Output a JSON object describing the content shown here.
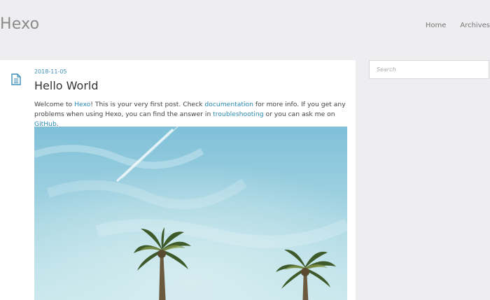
{
  "site": {
    "title": "Hexo"
  },
  "nav": {
    "items": [
      {
        "label": "Home"
      },
      {
        "label": "Archives"
      }
    ]
  },
  "post": {
    "date": "2018-11-05",
    "title": "Hello World",
    "text": {
      "p1": "Welcome to ",
      "link_hexo": "Hexo",
      "p2": "! This is your very first post. Check ",
      "link_docs": "documentation",
      "p3": " for more info. If you get any problems when using Hexo, you can find the answer in ",
      "link_trouble": "troubleshooting",
      "p4": " or you can ask me on ",
      "link_github": "GitHub",
      "p5": "."
    }
  },
  "sidebar": {
    "search": {
      "placeholder": "Search",
      "value": ""
    }
  },
  "icons": {
    "post_icon": "document-icon"
  },
  "colors": {
    "accent": "#2a8ab3",
    "background": "#eeedf0",
    "card": "#ffffff"
  }
}
